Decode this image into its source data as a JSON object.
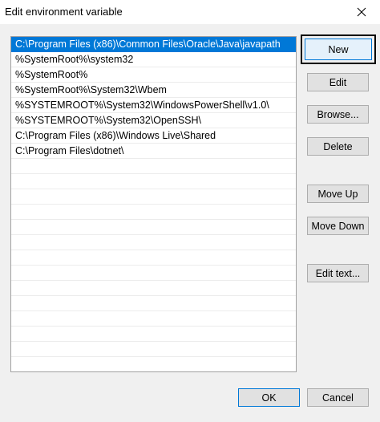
{
  "window": {
    "title": "Edit environment variable"
  },
  "paths": [
    "C:\\Program Files (x86)\\Common Files\\Oracle\\Java\\javapath",
    "%SystemRoot%\\system32",
    "%SystemRoot%",
    "%SystemRoot%\\System32\\Wbem",
    "%SYSTEMROOT%\\System32\\WindowsPowerShell\\v1.0\\",
    "%SYSTEMROOT%\\System32\\OpenSSH\\",
    "C:\\Program Files (x86)\\Windows Live\\Shared",
    "C:\\Program Files\\dotnet\\"
  ],
  "selected_index": 0,
  "buttons": {
    "new": "New",
    "edit": "Edit",
    "browse": "Browse...",
    "delete": "Delete",
    "move_up": "Move Up",
    "move_down": "Move Down",
    "edit_text": "Edit text...",
    "ok": "OK",
    "cancel": "Cancel"
  },
  "colors": {
    "selection": "#0078d7",
    "background": "#f0f0f0"
  }
}
